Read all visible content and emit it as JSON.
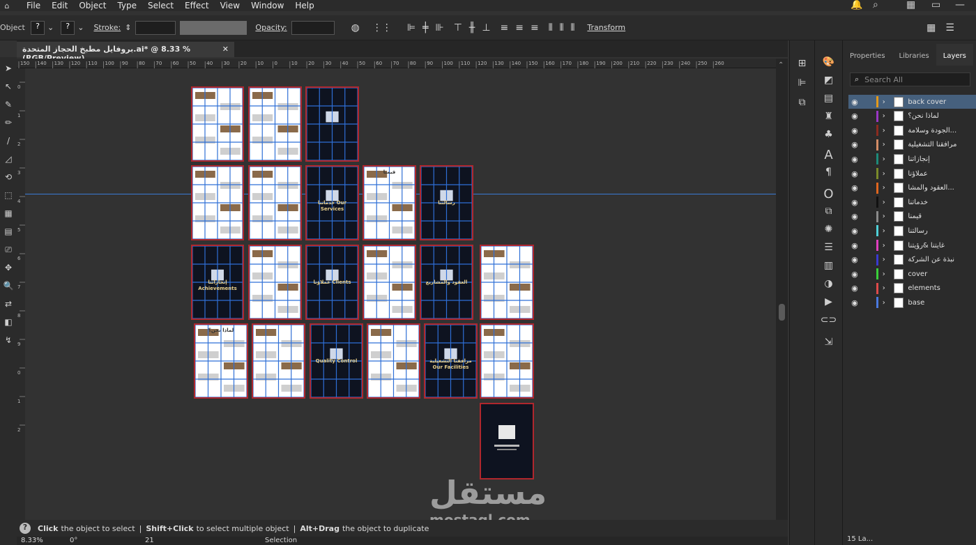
{
  "menu": [
    "File",
    "Edit",
    "Object",
    "Type",
    "Select",
    "Effect",
    "View",
    "Window",
    "Help"
  ],
  "control": {
    "objects_label": "Objects",
    "stroke_label": "Stroke:",
    "opacity_label": "Opacity:",
    "transform_label": "Transform",
    "q1": "?",
    "q2": "?"
  },
  "document": {
    "tab_title": "بروفايل مطبخ الحجاز المتحدة.ai* @ 8.33 % (RGB/Preview)",
    "close": "✕",
    "zoom": "8.33%",
    "page": "21"
  },
  "ruler": {
    "h_ticks": [
      "150",
      "140",
      "130",
      "120",
      "110",
      "100",
      "90",
      "80",
      "70",
      "60",
      "50",
      "40",
      "30",
      "20",
      "10",
      "0",
      "10",
      "20",
      "30",
      "40",
      "50",
      "60",
      "70",
      "80",
      "90",
      "100",
      "110",
      "120",
      "130",
      "140",
      "150",
      "160",
      "170",
      "180",
      "190",
      "200",
      "210",
      "220",
      "230",
      "240",
      "250",
      "260"
    ],
    "v_ticks": [
      "0",
      "1",
      "2",
      "3",
      "4",
      "5",
      "6",
      "7",
      "8",
      "9",
      "0",
      "1",
      "2"
    ]
  },
  "status": {
    "hint_1_bold": "Click",
    "hint_1": "the object to select",
    "hint_2_bold": "Shift+Click",
    "hint_2": "to select multiple object",
    "hint_3_bold": "Alt+Drag",
    "hint_3": "the object to duplicate",
    "mode": "Selection",
    "zoom_field": "8.33%",
    "angle_field": "0°",
    "page_field": "21"
  },
  "panel": {
    "tabs": [
      "Properties",
      "Libraries",
      "Layers"
    ],
    "active_tab": "Layers",
    "search_placeholder": "Search All",
    "footer_label": "15 La...",
    "layers": [
      {
        "name": "back cover",
        "color": "#e49a1a",
        "selected": true
      },
      {
        "name": "لماذا نحن؟",
        "color": "#9a37c4",
        "selected": false
      },
      {
        "name": "الجودة وسلامة...",
        "color": "#8b2b1f",
        "selected": false
      },
      {
        "name": "مرافقنا التشغيلية",
        "color": "#d48c66",
        "selected": false
      },
      {
        "name": "إنجازاتنا",
        "color": "#1d8a7a",
        "selected": false
      },
      {
        "name": "عملاؤنا",
        "color": "#7a8a2a",
        "selected": false
      },
      {
        "name": "العقود والمشا...",
        "color": "#e0661e",
        "selected": false
      },
      {
        "name": "خدماتنا",
        "color": "#111111",
        "selected": false
      },
      {
        "name": "قيمنا",
        "color": "#8a8a8a",
        "selected": false
      },
      {
        "name": "رسالتنا",
        "color": "#4fd0d8",
        "selected": false
      },
      {
        "name": "غايتنا &رؤيتنا",
        "color": "#e03fbf",
        "selected": false
      },
      {
        "name": "نبذة عن الشركة",
        "color": "#3a3ad0",
        "selected": false
      },
      {
        "name": "cover",
        "color": "#3ad03a",
        "selected": false
      },
      {
        "name": "elements",
        "color": "#e04a4a",
        "selected": false
      },
      {
        "name": "base",
        "color": "#4a7ae0",
        "selected": false
      }
    ]
  },
  "artboards": [
    {
      "label": "",
      "theme": "light"
    },
    {
      "label": "",
      "theme": "light"
    },
    {
      "label": "",
      "theme": "dark"
    },
    {
      "label": "",
      "theme": "light"
    },
    {
      "label": "",
      "theme": "light"
    },
    {
      "label": "خدماتنا Our Services",
      "theme": "dark"
    },
    {
      "label": "قيمنا",
      "theme": "light"
    },
    {
      "label": "رسالتنا",
      "theme": "dark"
    },
    {
      "label": "إنجازاتنا Achievements",
      "theme": "dark"
    },
    {
      "label": "",
      "theme": "light"
    },
    {
      "label": "عملاؤنا Clients",
      "theme": "dark"
    },
    {
      "label": "",
      "theme": "light"
    },
    {
      "label": "العقود والمشاريع",
      "theme": "dark"
    },
    {
      "label": "",
      "theme": "light"
    },
    {
      "label": "لماذا نحن؟",
      "theme": "light"
    },
    {
      "label": "",
      "theme": "light"
    },
    {
      "label": "Quality Control",
      "theme": "dark"
    },
    {
      "label": "",
      "theme": "light"
    },
    {
      "label": "مرافقنا التشغيلية Our Facilities",
      "theme": "dark"
    },
    {
      "label": "",
      "theme": "light"
    },
    {
      "label": "",
      "theme": "dark"
    }
  ],
  "watermark": {
    "arabic": "مستقل",
    "latin": "mostaql.com"
  },
  "colors": {
    "accent": "#46607d",
    "artboard_border": "#b0272d",
    "grid": "#2f6fd6",
    "guide": "#3a7bd5"
  }
}
